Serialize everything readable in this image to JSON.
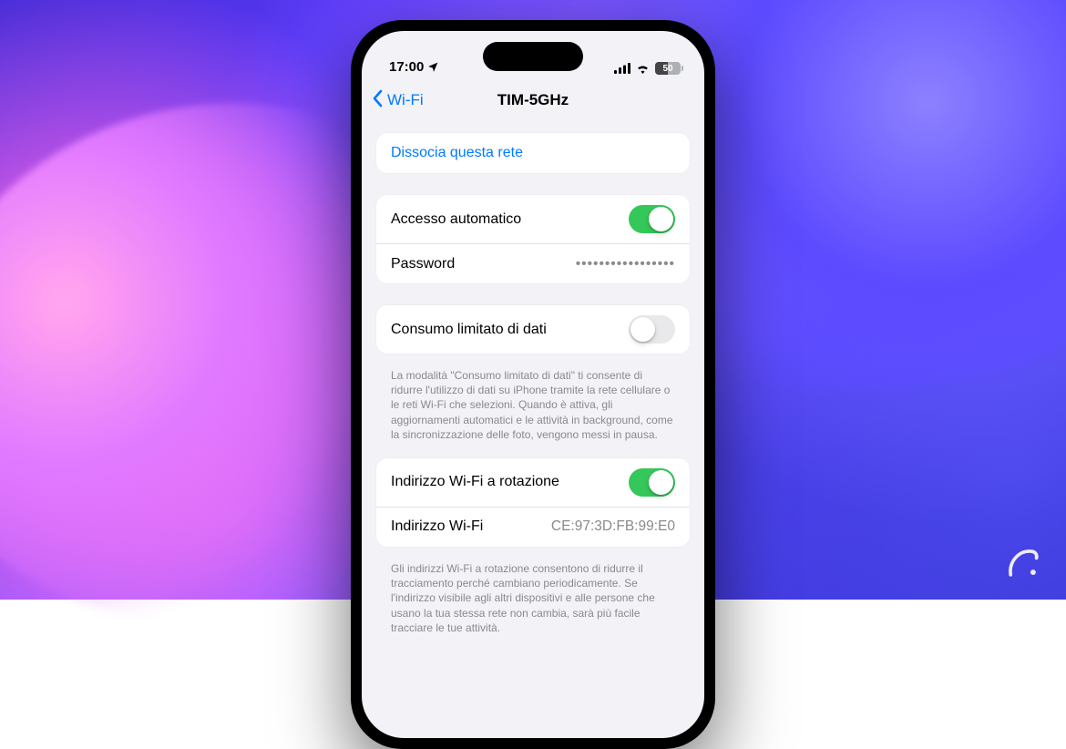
{
  "statusbar": {
    "time": "17:00",
    "battery_percent": "50"
  },
  "nav": {
    "back_label": "Wi-Fi",
    "title": "TIM-5GHz"
  },
  "groups": {
    "forget": {
      "label": "Dissocia questa rete"
    },
    "auto": {
      "auto_join_label": "Accesso automatico",
      "auto_join_on": true,
      "password_label": "Password",
      "password_mask": "•••••••••••••••••"
    },
    "lowdata": {
      "label": "Consumo limitato di dati",
      "on": false,
      "footer": "La modalità \"Consumo limitato di dati\" ti consente di ridurre l'utilizzo di dati su iPhone tramite la rete cellulare o le reti Wi-Fi che selezioni. Quando è attiva, gli aggiornamenti automatici e le attività in background, come la sincronizzazione delle foto, vengono messi in pausa."
    },
    "mac": {
      "private_label": "Indirizzo Wi-Fi a rotazione",
      "private_on": true,
      "addr_label": "Indirizzo Wi-Fi",
      "addr_value": "CE:97:3D:FB:99:E0",
      "footer": "Gli indirizzi Wi-Fi a rotazione consentono di ridurre il tracciamento perché cambiano periodicamente. Se l'indirizzo visibile agli altri dispositivi e alle persone che usano la tua stessa rete non cambia, sarà più facile tracciare le tue attività."
    }
  }
}
